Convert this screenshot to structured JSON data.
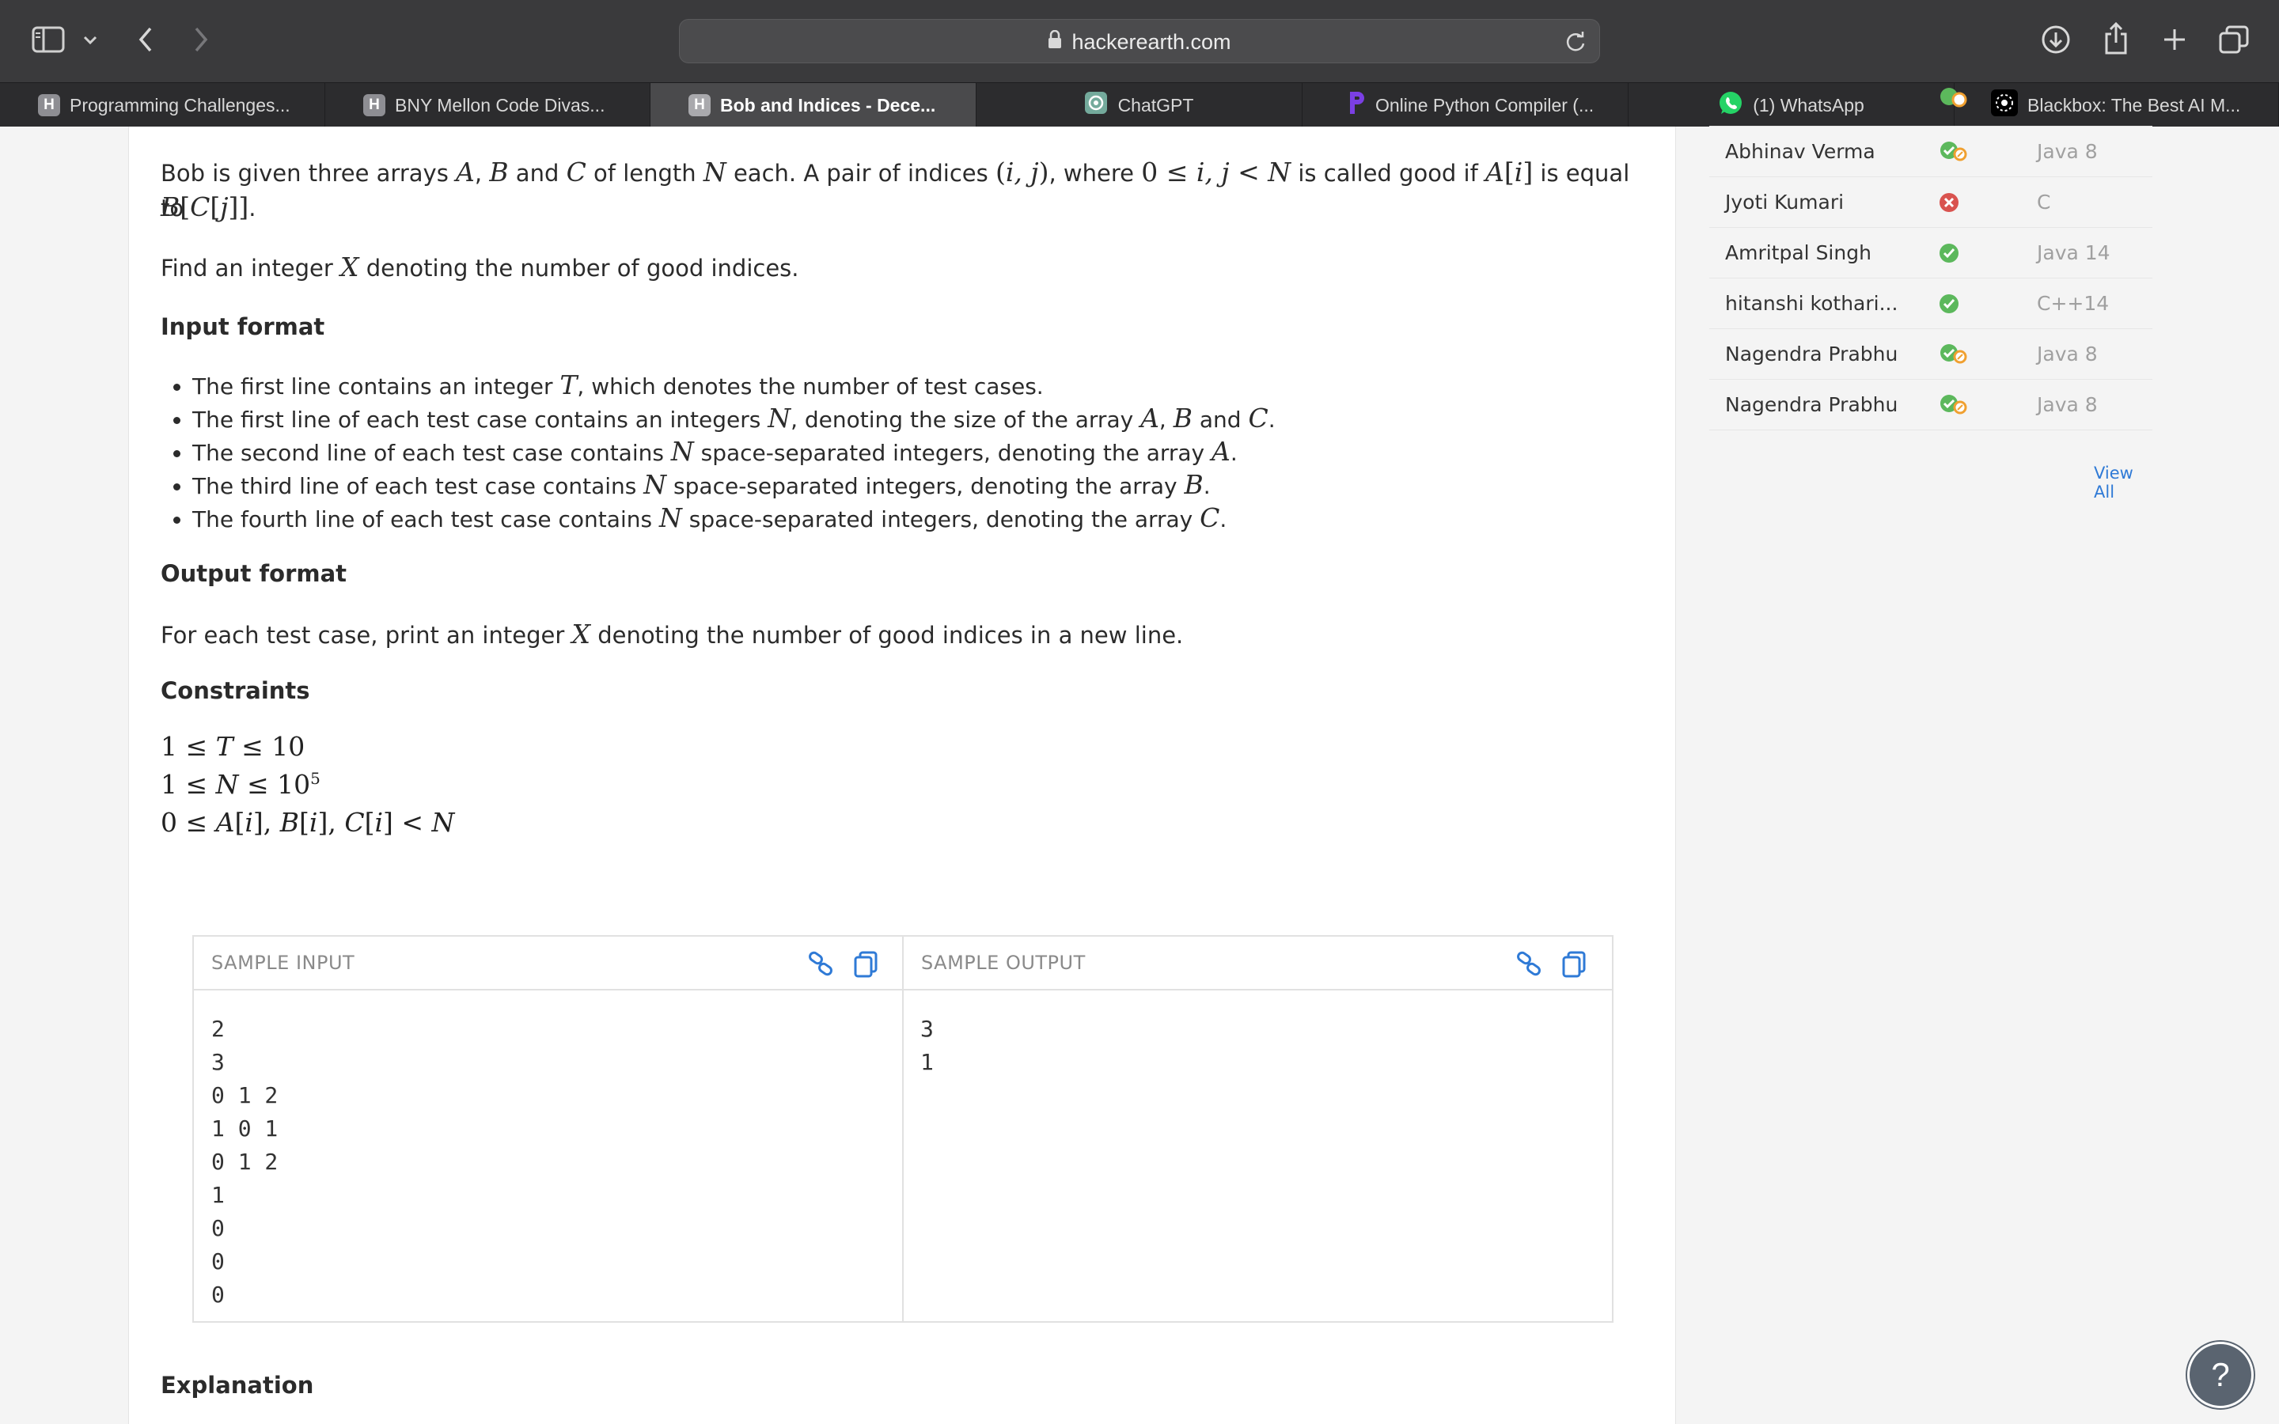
{
  "browser": {
    "url": "hackerearth.com",
    "tabs": [
      {
        "label": "Programming Challenges...",
        "favicon": "H"
      },
      {
        "label": "BNY Mellon Code Divas...",
        "favicon": "H"
      },
      {
        "label": "Bob and Indices - Dece...",
        "favicon": "H",
        "active": true
      },
      {
        "label": "ChatGPT",
        "favicon": "chatgpt-icon"
      },
      {
        "label": "Online Python Compiler (...",
        "favicon": "python-icon"
      },
      {
        "label": "(1) WhatsApp",
        "favicon": "whatsapp-icon"
      },
      {
        "label": "Blackbox: The Best AI M...",
        "favicon": "blackbox-icon"
      }
    ]
  },
  "problem": {
    "intro_1": "Bob is given three arrays",
    "intro_2": "each. A pair of indices",
    "intro_3": "where",
    "intro_4": "is called good if",
    "intro_5": "is equal to",
    "find": "Find an integer",
    "find_2": "denoting the number of good indices.",
    "input_heading": "Input format",
    "bullets": [
      "The first line contains an integer T, which denotes the number of test cases.",
      "The first line of each test case contains an integers N, denoting the size of the array A, B and C.",
      "The second line of each test case contains N space-separated integers, denoting the array A.",
      "The third line of each test case contains N space-separated integers, denoting the array B.",
      "The fourth line of each test case contains N space-separated integers, denoting the array C."
    ],
    "output_heading": "Output format",
    "output_text_1": "For each test case, print an integer",
    "output_text_2": "denoting the number of good indices in a new line.",
    "constraints_heading": "Constraints",
    "constraints": [
      "1 ≤ T ≤ 10",
      "1 ≤ N ≤ 10",
      "0 ≤ A[i], B[i], C[i] < N"
    ],
    "explanation_heading": "Explanation"
  },
  "sample": {
    "input_label": "SAMPLE INPUT",
    "output_label": "SAMPLE OUTPUT",
    "input_lines": "2\n3\n0 1 2\n1 0 1\n0 1 2\n1\n0\n0\n0",
    "output_lines": "3\n1"
  },
  "submissions": {
    "rows": [
      {
        "name": "Abhinav Verma",
        "status": "partial",
        "lang": "Java 8"
      },
      {
        "name": "Jyoti Kumari",
        "status": "failed",
        "lang": "C"
      },
      {
        "name": "Amritpal Singh",
        "status": "accepted",
        "lang": "Java 14"
      },
      {
        "name": "hitanshi kothari...",
        "status": "accepted",
        "lang": "C++14"
      },
      {
        "name": "Nagendra Prabhu",
        "status": "partial",
        "lang": "Java 8"
      },
      {
        "name": "Nagendra Prabhu",
        "status": "partial",
        "lang": "Java 8"
      }
    ],
    "view_all": "View All"
  },
  "help": "?"
}
